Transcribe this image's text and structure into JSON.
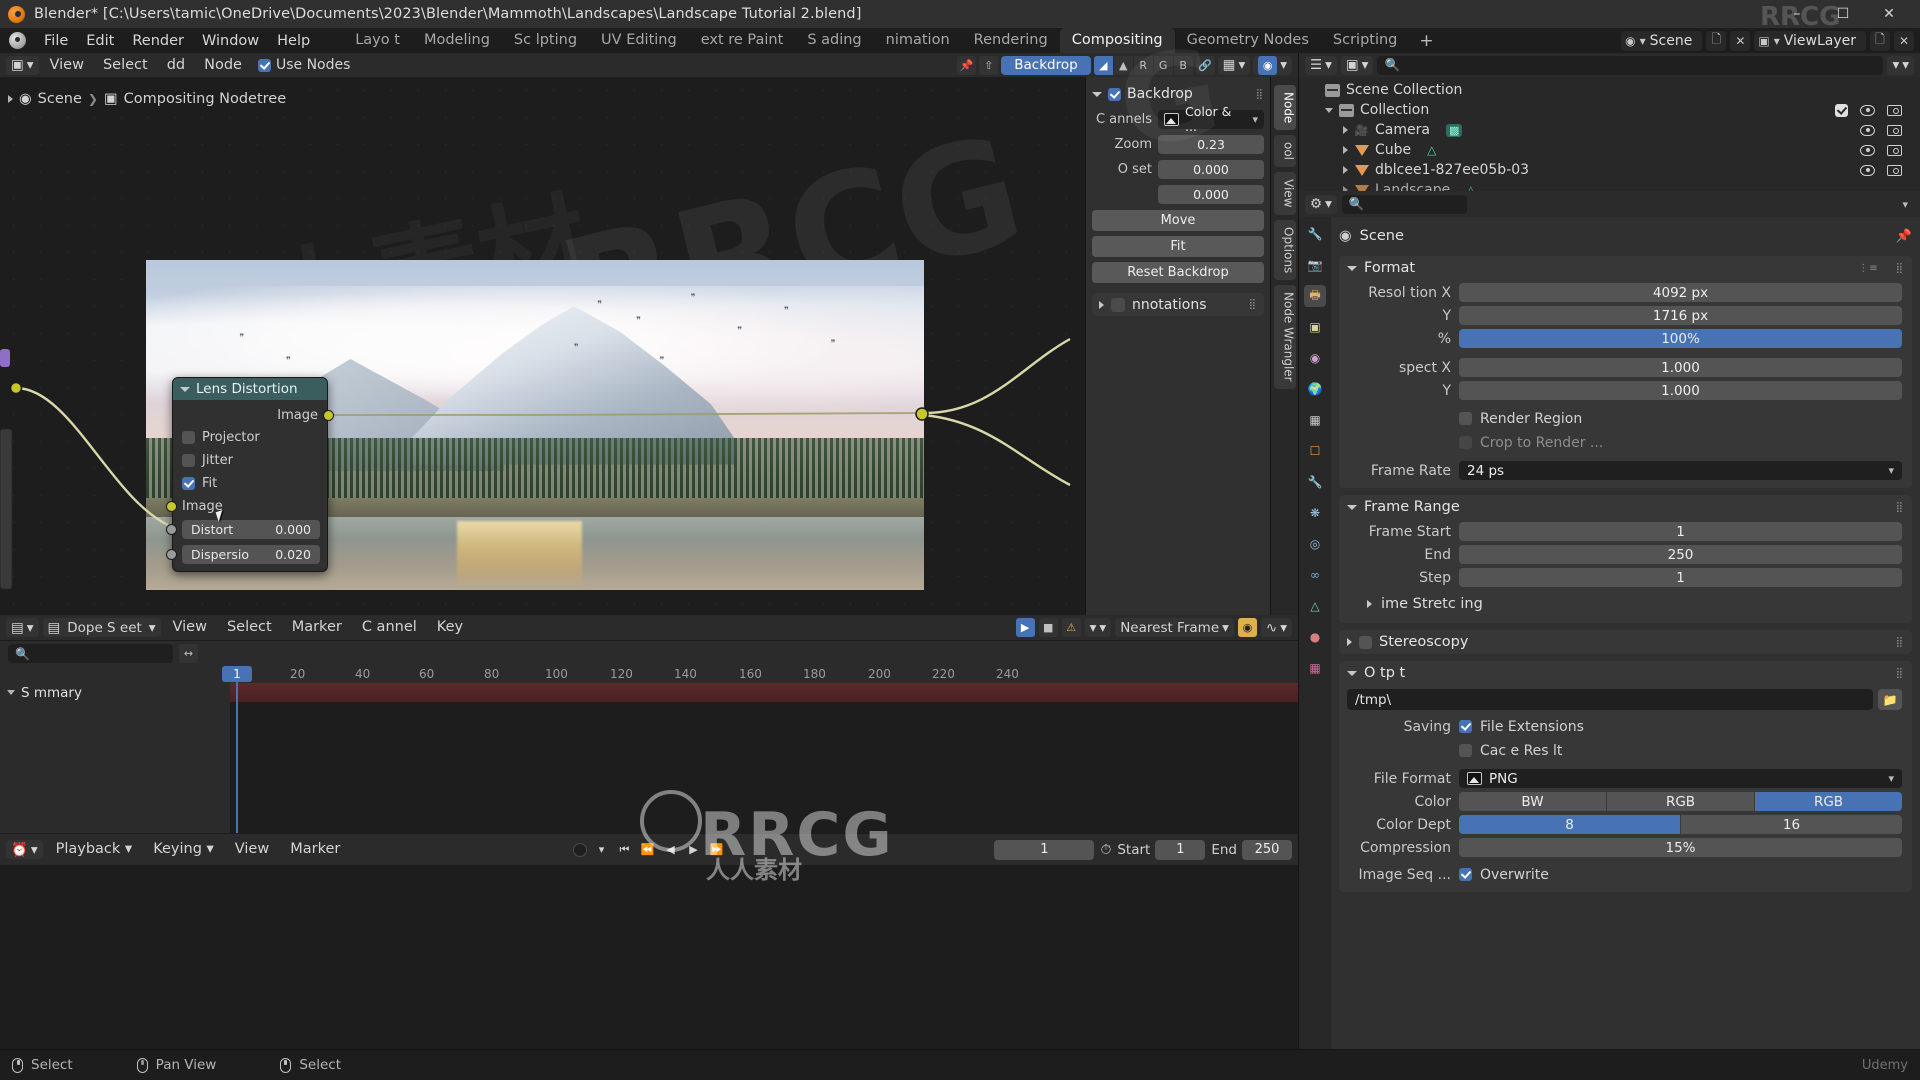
{
  "titlebar": {
    "title": "Blender* [C:\\Users\\tamic\\OneDrive\\Documents\\2023\\Blender\\Mammoth\\Landscapes\\Landscape Tutorial 2.blend]",
    "minimize": "–",
    "maximize": "☐",
    "close": "✕"
  },
  "topbar": {
    "menus": [
      "File",
      "Edit",
      "Render",
      "Window",
      "Help"
    ],
    "workspaces": [
      "Layo t",
      "Modeling",
      "Sc lpting",
      "UV Editing",
      "ext re Paint",
      "S ading",
      "nimation",
      "Rendering",
      "Compositing",
      "Geometry Nodes",
      "Scripting"
    ],
    "active_workspace": "Compositing",
    "add_tab": "+",
    "scene_name": "Scene",
    "viewlayer_name": "ViewLayer"
  },
  "node_editor": {
    "header": {
      "editor_type": "compositor-icon",
      "menus": [
        "View",
        "Select",
        "dd",
        "Node"
      ],
      "use_nodes_label": "Use Nodes",
      "use_nodes_checked": true,
      "backdrop_label": "Backdrop",
      "channel_buttons": [
        "◧",
        "▲",
        "R",
        "G",
        "B"
      ],
      "snap_icon": "magnet-icon",
      "overlay_icon": "overlays-icon"
    },
    "breadcrumb": [
      "Scene",
      "Compositing Nodetree"
    ],
    "node": {
      "title": "Lens Distortion",
      "output_socket_label": "Image",
      "checkboxes": [
        {
          "label": "Projector",
          "checked": false
        },
        {
          "label": "Jitter",
          "checked": false
        },
        {
          "label": "Fit",
          "checked": true
        }
      ],
      "input_image_label": "Image",
      "values": [
        {
          "label": "Distort",
          "value": "0.000"
        },
        {
          "label": "Dispersio",
          "value": "0.020"
        }
      ]
    },
    "sidebar": {
      "backdrop": {
        "title": "Backdrop",
        "enabled": true,
        "channels_label": "C annels",
        "channels_value": "Color & ...",
        "zoom_label": "Zoom",
        "zoom_value": "0.23",
        "offset_label": "O set",
        "offset_x": "0.000",
        "offset_y": "0.000",
        "move_label": "Move",
        "fit_label": "Fit",
        "reset_label": "Reset Backdrop"
      },
      "annotations_label": "nnotations",
      "tabs": [
        "Node",
        "ool",
        "View",
        "Options",
        "Node Wrangler"
      ]
    }
  },
  "outliner": {
    "display_mode": "View Layer",
    "search_placeholder": "",
    "filter_icon": "filter-icon",
    "rows": [
      {
        "label": "Scene Collection",
        "icon": "collection-icon",
        "indent": 0,
        "expander": "none",
        "checkbox": false,
        "eye": false,
        "camera": false
      },
      {
        "label": "Collection",
        "icon": "collection-icon",
        "indent": 1,
        "expander": "down",
        "checkbox": true,
        "eye": true,
        "camera": true
      },
      {
        "label": "Camera",
        "icon": "camera-icon",
        "indent": 2,
        "expander": "right",
        "checkbox": false,
        "eye": true,
        "camera": true
      },
      {
        "label": "Cube",
        "icon": "mesh-icon",
        "indent": 2,
        "expander": "right",
        "checkbox": false,
        "eye": true,
        "camera": true
      },
      {
        "label": "dblcee1-827ee05b-03",
        "icon": "mesh-icon",
        "indent": 2,
        "expander": "right",
        "checkbox": false,
        "eye": true,
        "camera": true
      },
      {
        "label": "Landscape",
        "icon": "mesh-icon",
        "indent": 2,
        "expander": "right",
        "checkbox": false,
        "eye": true,
        "camera": true
      }
    ]
  },
  "properties": {
    "editor_search_placeholder": "",
    "context_label": "Scene",
    "pin_icon": "pin-icon",
    "tabs": [
      "tool-icon",
      "render-icon",
      "output-icon",
      "viewlayer-icon",
      "scene-icon",
      "world-icon",
      "collection-icon",
      "object-icon",
      "modifier-icon",
      "particles-icon",
      "physics-icon",
      "constraint-icon",
      "data-icon",
      "material-icon",
      "texture-icon"
    ],
    "active_tab_index": 2,
    "format": {
      "title": "Format",
      "resolution_x_label": "Resol tion X",
      "resolution_x": "4092 px",
      "resolution_y_label": "Y",
      "resolution_y": "1716 px",
      "percent_label": "%",
      "percent": "100%",
      "aspect_x_label": "spect X",
      "aspect_x": "1.000",
      "aspect_y_label": "Y",
      "aspect_y": "1.000",
      "render_region_label": "Render Region",
      "render_region_checked": false,
      "crop_label": "Crop to Render ...",
      "crop_checked": false,
      "frame_rate_label": "Frame Rate",
      "frame_rate": "24  ps"
    },
    "frame_range": {
      "title": "Frame Range",
      "start_label": "Frame Start",
      "start": "1",
      "end_label": "End",
      "end": "250",
      "step_label": "Step",
      "step": "1",
      "time_stretching_label": "ime Stretc ing"
    },
    "stereoscopy": {
      "title": "Stereoscopy",
      "checked": false
    },
    "output": {
      "title": "O tp t",
      "path": "/tmp\\",
      "folder_icon": "folder-icon",
      "saving_label": "Saving",
      "file_extensions_label": "File Extensions",
      "file_extensions_checked": true,
      "cache_label": "Cac e Res lt",
      "cache_checked": false,
      "file_format_label": "File Format",
      "file_format": "PNG",
      "color_label": "Color",
      "color_options": [
        "BW",
        "RGB",
        "RGB"
      ],
      "color_active_index": 2,
      "color_depth_label": "Color Dept",
      "color_depth_options": [
        "8",
        "16"
      ],
      "color_depth_active_index": 0,
      "compression_label": "Compression",
      "compression": "15%",
      "image_seq_label": "Image Seq ...",
      "overwrite_label": "Overwrite",
      "overwrite_checked": true
    }
  },
  "dope_sheet": {
    "editor_name": "Dope S eet",
    "menus": [
      "View",
      "Select",
      "Marker",
      "C annel",
      "Key"
    ],
    "search_placeholder": "",
    "snap_mode": "Nearest Frame",
    "summary_label": "S mmary",
    "ruler_ticks": [
      "20",
      "40",
      "60",
      "80",
      "100",
      "120",
      "140",
      "160",
      "180",
      "200",
      "220",
      "240"
    ],
    "current_frame_badge": "1"
  },
  "timeline_footer": {
    "playback_label": "Playback",
    "keying_label": "Keying",
    "view_label": "View",
    "marker_label": "Marker",
    "current_frame": "1",
    "start_label": "Start",
    "start": "1",
    "end_label": "End",
    "end": "250",
    "transport": [
      "⏮",
      "⏪",
      "◀",
      "▶",
      "⏩"
    ]
  },
  "statusbar": {
    "left_select": "Select",
    "pan_view": "Pan View",
    "right_select": "Select"
  },
  "colors": {
    "accent_blue": "#4772b3",
    "node_header_teal": "#3a5e5e",
    "image_socket": "#c7c729",
    "panel_bg": "#303030",
    "editor_bg": "#1d1d1d"
  }
}
